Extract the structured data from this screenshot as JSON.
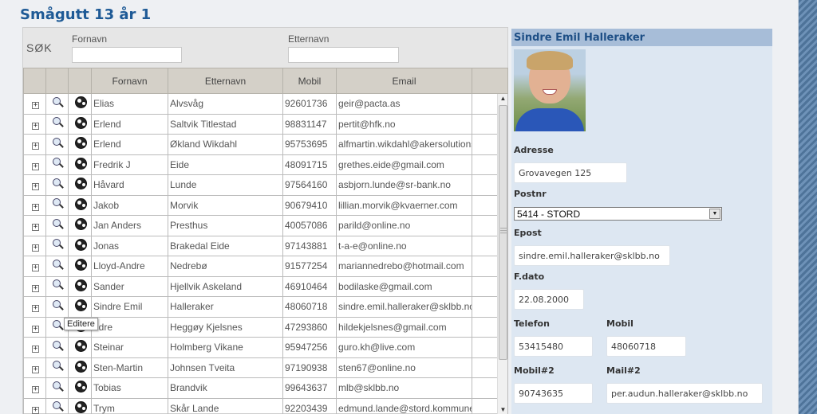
{
  "page_title": "Smågutt 13 år 1",
  "search": {
    "label": "SØK",
    "fornavn_label": "Fornavn",
    "etternavn_label": "Etternavn",
    "fornavn_value": "",
    "etternavn_value": ""
  },
  "table": {
    "headers": [
      "",
      "",
      "",
      "Fornavn",
      "Etternavn",
      "Mobil",
      "Email",
      ""
    ],
    "rows": [
      {
        "fornavn": "Elias",
        "etternavn": "Alvsvåg",
        "mobil": "92601736",
        "email": "geir@pacta.as"
      },
      {
        "fornavn": "Erlend",
        "etternavn": "Saltvik Titlestad",
        "mobil": "98831147",
        "email": "pertit@hfk.no"
      },
      {
        "fornavn": "Erlend",
        "etternavn": "Økland Wikdahl",
        "mobil": "95753695",
        "email": "alfmartin.wikdahl@akersolutions."
      },
      {
        "fornavn": "Fredrik J",
        "etternavn": "Eide",
        "mobil": "48091715",
        "email": "grethes.eide@gmail.com"
      },
      {
        "fornavn": "Håvard",
        "etternavn": "Lunde",
        "mobil": "97564160",
        "email": "asbjorn.lunde@sr-bank.no"
      },
      {
        "fornavn": "Jakob",
        "etternavn": "Morvik",
        "mobil": "90679410",
        "email": "lillian.morvik@kvaerner.com"
      },
      {
        "fornavn": "Jan Anders",
        "etternavn": "Presthus",
        "mobil": "40057086",
        "email": "parild@online.no"
      },
      {
        "fornavn": "Jonas",
        "etternavn": "Brakedal Eide",
        "mobil": "97143881",
        "email": "t-a-e@online.no"
      },
      {
        "fornavn": "Lloyd-Andre",
        "etternavn": "Nedrebø",
        "mobil": "91577254",
        "email": "mariannedrebo@hotmail.com"
      },
      {
        "fornavn": "Sander",
        "etternavn": "Hjellvik Askeland",
        "mobil": "46910464",
        "email": "bodilaske@gmail.com"
      },
      {
        "fornavn": "Sindre Emil",
        "etternavn": "Halleraker",
        "mobil": "48060718",
        "email": "sindre.emil.halleraker@sklbb.no"
      },
      {
        "fornavn": "ndre",
        "etternavn": "Heggøy Kjelsnes",
        "mobil": "47293860",
        "email": "hildekjelsnes@gmail.com"
      },
      {
        "fornavn": "Steinar",
        "etternavn": "Holmberg Vikane",
        "mobil": "95947256",
        "email": "guro.kh@live.com"
      },
      {
        "fornavn": "Sten-Martin",
        "etternavn": "Johnsen Tveita",
        "mobil": "97190938",
        "email": "sten67@online.no"
      },
      {
        "fornavn": "Tobias",
        "etternavn": "Brandvik",
        "mobil": "99643637",
        "email": "mlb@sklbb.no"
      },
      {
        "fornavn": "Trym",
        "etternavn": "Skår Lande",
        "mobil": "92203439",
        "email": "edmund.lande@stord.kommune."
      }
    ]
  },
  "tooltip": "Editere",
  "detail": {
    "name": "Sindre Emil Halleraker",
    "adresse_label": "Adresse",
    "adresse": "Grovavegen 125",
    "postnr_label": "Postnr",
    "postnr": "5414 - STORD",
    "epost_label": "Epost",
    "epost": "sindre.emil.halleraker@sklbb.no",
    "fdato_label": "F.dato",
    "fdato": "22.08.2000",
    "telefon_label": "Telefon",
    "telefon": "53415480",
    "mobil_label": "Mobil",
    "mobil": "48060718",
    "mobil2_label": "Mobil#2",
    "mobil2": "90743635",
    "mail2_label": "Mail#2",
    "mail2": "per.audun.halleraker@sklbb.no"
  },
  "icons": {
    "expand": "plus-box-icon",
    "view": "magnifier-icon",
    "edit": "football-icon"
  }
}
